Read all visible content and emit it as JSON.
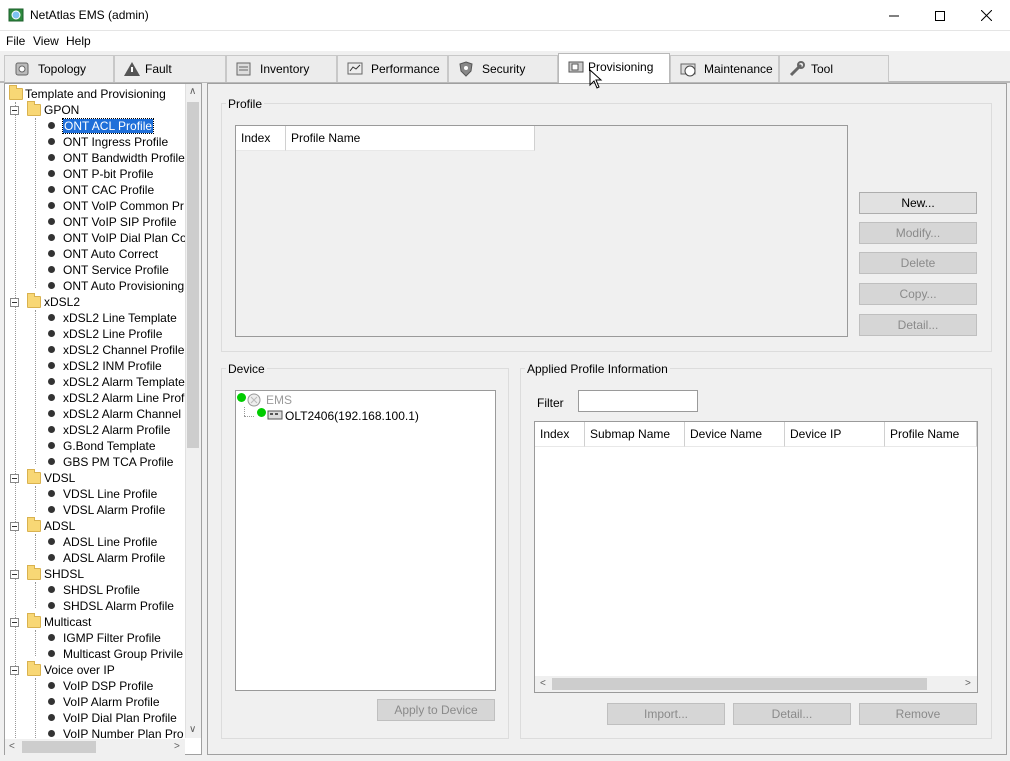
{
  "window": {
    "title": "NetAtlas EMS (admin)",
    "controls": [
      "minimize-icon",
      "maximize-icon",
      "close-icon"
    ]
  },
  "menu": [
    "File",
    "View",
    "Help"
  ],
  "tabs": [
    {
      "label": "Topology",
      "icon": "topology-icon"
    },
    {
      "label": "Fault",
      "icon": "warning-icon"
    },
    {
      "label": "Inventory",
      "icon": "inventory-icon"
    },
    {
      "label": "Performance",
      "icon": "performance-icon"
    },
    {
      "label": "Security",
      "icon": "shield-icon"
    },
    {
      "label": "Provisioning",
      "icon": "provisioning-icon",
      "active": true
    },
    {
      "label": "Maintenance",
      "icon": "maintenance-icon"
    },
    {
      "label": "Tool",
      "icon": "wrench-icon"
    }
  ],
  "tree": {
    "root": "Template and Provisioning",
    "selected": "ONT ACL Profile",
    "groups": [
      {
        "name": "GPON",
        "items": [
          "ONT ACL Profile",
          "ONT Ingress Profile",
          "ONT Bandwidth Profile",
          "ONT P-bit Profile",
          "ONT CAC Profile",
          "ONT VoIP Common Pr",
          "ONT VoIP SIP Profile",
          "ONT VoIP Dial Plan Co",
          "ONT Auto Correct",
          "ONT Service Profile",
          "ONT Auto Provisioning"
        ]
      },
      {
        "name": "xDSL2",
        "items": [
          "xDSL2 Line Template",
          "xDSL2 Line Profile",
          "xDSL2 Channel Profile",
          "xDSL2 INM Profile",
          "xDSL2 Alarm Template",
          "xDSL2 Alarm Line Prof",
          "xDSL2 Alarm Channel",
          "xDSL2 Alarm Profile",
          "G.Bond Template",
          "GBS PM TCA Profile"
        ]
      },
      {
        "name": "VDSL",
        "items": [
          "VDSL Line Profile",
          "VDSL Alarm Profile"
        ]
      },
      {
        "name": "ADSL",
        "items": [
          "ADSL Line Profile",
          "ADSL Alarm Profile"
        ]
      },
      {
        "name": "SHDSL",
        "items": [
          "SHDSL Profile",
          "SHDSL Alarm Profile"
        ]
      },
      {
        "name": "Multicast",
        "items": [
          "IGMP Filter Profile",
          "Multicast Group Privile"
        ]
      },
      {
        "name": "Voice over IP",
        "items": [
          "VoIP DSP Profile",
          "VoIP Alarm Profile",
          "VoIP Dial Plan Profile",
          "VoIP Number Plan Pro"
        ]
      }
    ]
  },
  "profile": {
    "group_label": "Profile",
    "columns": [
      "Index",
      "Profile Name"
    ],
    "buttons": [
      {
        "label": "New...",
        "enabled": true
      },
      {
        "label": "Modify...",
        "enabled": false
      },
      {
        "label": "Delete",
        "enabled": false
      },
      {
        "label": "Copy...",
        "enabled": false
      },
      {
        "label": "Detail...",
        "enabled": false
      }
    ]
  },
  "device": {
    "group_label": "Device",
    "root": "EMS",
    "node": "OLT2406(192.168.100.1)",
    "apply_button": "Apply to Device"
  },
  "applied": {
    "group_label": "Applied Profile Information",
    "filter_label": "Filter",
    "filter_value": "",
    "columns": [
      "Index",
      "Submap Name",
      "Device Name",
      "Device IP",
      "Profile Name"
    ],
    "buttons": [
      {
        "label": "Import...",
        "enabled": false
      },
      {
        "label": "Detail...",
        "enabled": false
      },
      {
        "label": "Remove",
        "enabled": false
      }
    ]
  },
  "colors": {
    "selection": "#1f6fd9",
    "status_dot": "#00cc00",
    "folder": "#f8d775"
  }
}
